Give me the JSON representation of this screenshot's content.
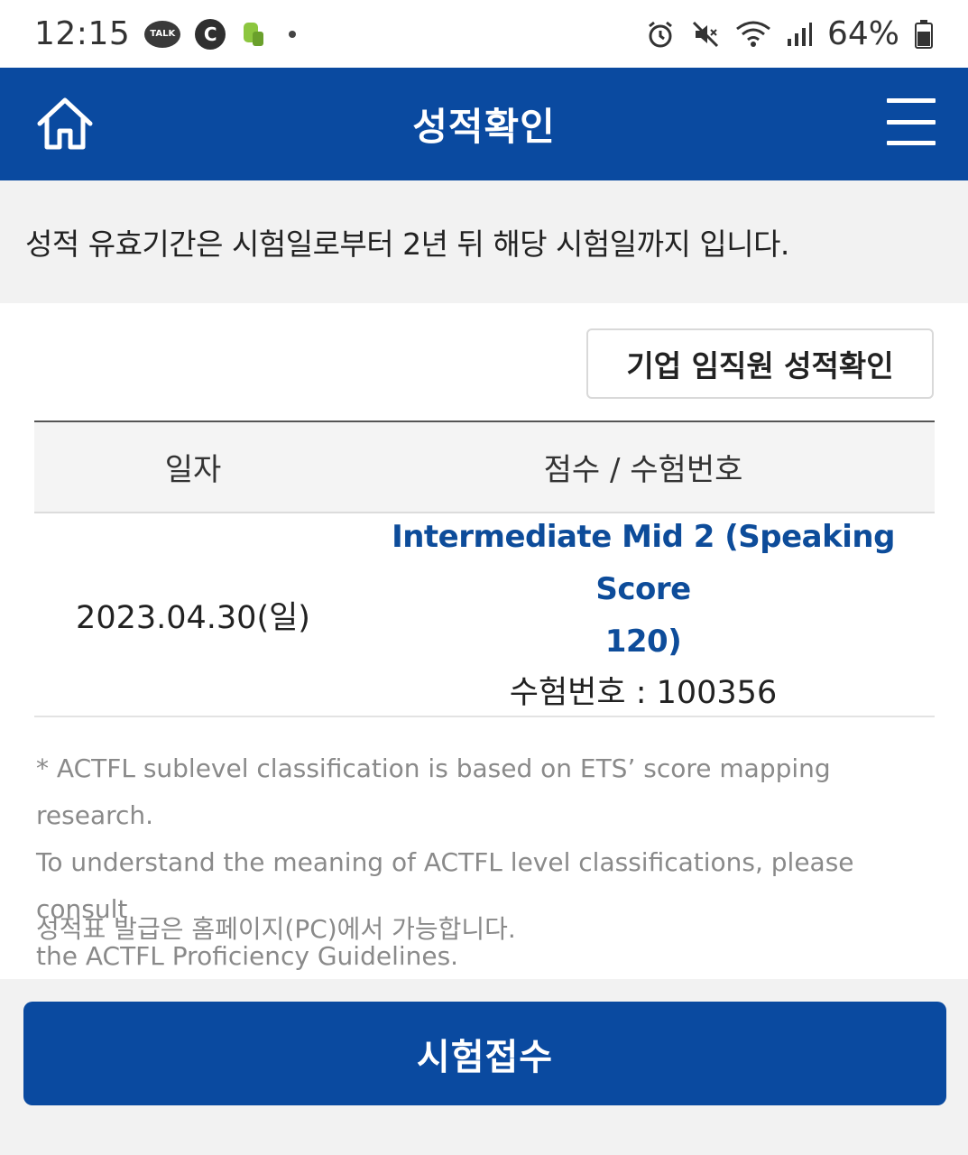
{
  "status_bar": {
    "time": "12:15",
    "talk_label": "TALK",
    "c_label": "C",
    "battery": "64%",
    "icons": [
      "kakaotalk-icon",
      "c-app-icon",
      "bip-app-icon",
      "alarm-icon",
      "mute-icon",
      "wifi-icon",
      "signal-icon",
      "battery-icon"
    ]
  },
  "header": {
    "title": "성적확인",
    "home_icon": "home-icon",
    "menu_icon": "hamburger-menu-icon",
    "color": "#0a4aa0"
  },
  "notice": {
    "text": "성적 유효기간은 시험일로부터 2년 뒤 해당 시험일까지 입니다."
  },
  "corporate_button": {
    "label": "기업 임직원 성적확인"
  },
  "table": {
    "headers": {
      "date": "일자",
      "score": "점수 / 수험번호"
    },
    "rows": [
      {
        "date": "2023.04.30(일)",
        "score_line1": "Intermediate Mid 2 (Speaking Score",
        "score_line2": "120)",
        "exam_no": "수험번호 : 100356"
      }
    ]
  },
  "footnote": {
    "line1": "* ACTFL sublevel classification is based on ETS’ score mapping research.",
    "line2": "To understand the meaning of ACTFL level classifications, please consult",
    "line3": "the ACTFL Proficiency Guidelines.",
    "pc_note": "성적표 발급은 홈페이지(PC)에서 가능합니다."
  },
  "bottom_button": {
    "label": "시험접수"
  },
  "colors": {
    "primary": "#0a4aa0",
    "link": "#0d4c9a",
    "muted_text": "#8a8a8a"
  }
}
